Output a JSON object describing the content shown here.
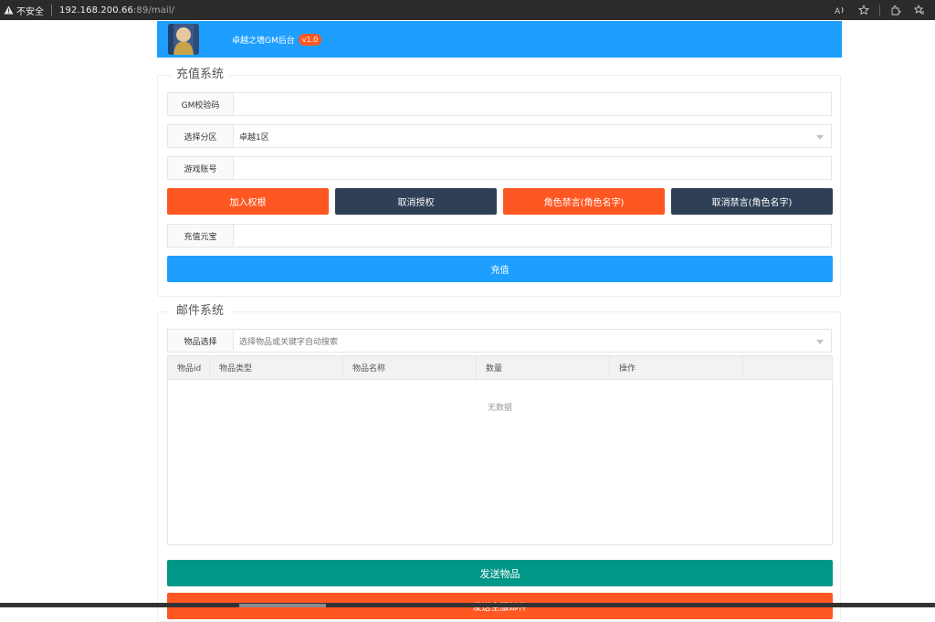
{
  "browser": {
    "insecure_label": "不安全",
    "url_host": "192.168.200.66",
    "url_rest": ":89/mail/",
    "icons": [
      "warning-icon",
      "read-aloud-icon",
      "favorite-add-icon",
      "extensions-icon",
      "favorites-icon"
    ]
  },
  "header": {
    "title": "卓越之墙GM后台",
    "version": "v1.0",
    "color": "#1e9fff"
  },
  "recharge": {
    "legend": "充值系统",
    "gm_code": {
      "label": "GM校验码",
      "value": ""
    },
    "zone": {
      "label": "选择分区",
      "value": "卓越1区"
    },
    "account": {
      "label": "游戏账号",
      "value": ""
    },
    "buttons": {
      "grant": "加入权根",
      "revoke": "取消授权",
      "mute": "角色禁言(角色名字)",
      "unmute": "取消禁言(角色名字)"
    },
    "gold": {
      "label": "充值元宝",
      "value": ""
    },
    "submit": "充值"
  },
  "mail": {
    "legend": "邮件系统",
    "item_select": {
      "label": "物品选择",
      "placeholder": "选择物品或关键字自动搜索"
    },
    "table": {
      "headers": [
        "物品id",
        "物品类型",
        "物品名称",
        "数量",
        "操作",
        ""
      ],
      "empty_text": "无数据"
    },
    "send_items": "发送物品",
    "send_all": "发送全服邮件"
  },
  "colors": {
    "orange": "#ff5722",
    "dark": "#2f4056",
    "blue": "#1e9fff",
    "green": "#009688"
  }
}
